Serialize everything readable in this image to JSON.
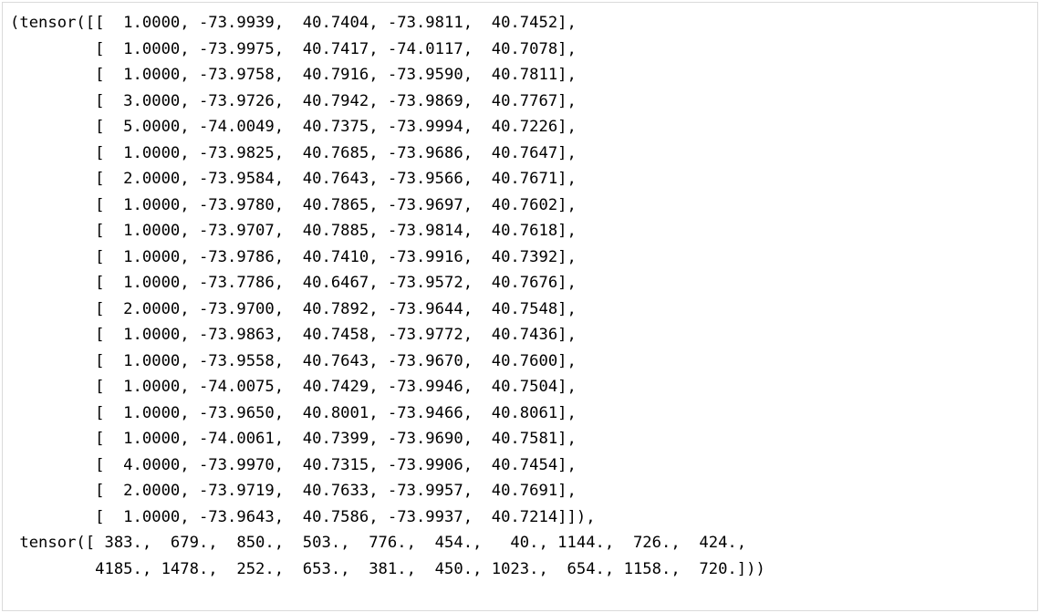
{
  "tensor1": {
    "rows": [
      [
        "  1.0000",
        "-73.9939",
        " 40.7404",
        "-73.9811",
        " 40.7452"
      ],
      [
        "  1.0000",
        "-73.9975",
        " 40.7417",
        "-74.0117",
        " 40.7078"
      ],
      [
        "  1.0000",
        "-73.9758",
        " 40.7916",
        "-73.9590",
        " 40.7811"
      ],
      [
        "  3.0000",
        "-73.9726",
        " 40.7942",
        "-73.9869",
        " 40.7767"
      ],
      [
        "  5.0000",
        "-74.0049",
        " 40.7375",
        "-73.9994",
        " 40.7226"
      ],
      [
        "  1.0000",
        "-73.9825",
        " 40.7685",
        "-73.9686",
        " 40.7647"
      ],
      [
        "  2.0000",
        "-73.9584",
        " 40.7643",
        "-73.9566",
        " 40.7671"
      ],
      [
        "  1.0000",
        "-73.9780",
        " 40.7865",
        "-73.9697",
        " 40.7602"
      ],
      [
        "  1.0000",
        "-73.9707",
        " 40.7885",
        "-73.9814",
        " 40.7618"
      ],
      [
        "  1.0000",
        "-73.9786",
        " 40.7410",
        "-73.9916",
        " 40.7392"
      ],
      [
        "  1.0000",
        "-73.7786",
        " 40.6467",
        "-73.9572",
        " 40.7676"
      ],
      [
        "  2.0000",
        "-73.9700",
        " 40.7892",
        "-73.9644",
        " 40.7548"
      ],
      [
        "  1.0000",
        "-73.9863",
        " 40.7458",
        "-73.9772",
        " 40.7436"
      ],
      [
        "  1.0000",
        "-73.9558",
        " 40.7643",
        "-73.9670",
        " 40.7600"
      ],
      [
        "  1.0000",
        "-74.0075",
        " 40.7429",
        "-73.9946",
        " 40.7504"
      ],
      [
        "  1.0000",
        "-73.9650",
        " 40.8001",
        "-73.9466",
        " 40.8061"
      ],
      [
        "  1.0000",
        "-74.0061",
        " 40.7399",
        "-73.9690",
        " 40.7581"
      ],
      [
        "  4.0000",
        "-73.9970",
        " 40.7315",
        "-73.9906",
        " 40.7454"
      ],
      [
        "  2.0000",
        "-73.9719",
        " 40.7633",
        "-73.9957",
        " 40.7691"
      ],
      [
        "  1.0000",
        "-73.9643",
        " 40.7586",
        "-73.9937",
        " 40.7214"
      ]
    ]
  },
  "tensor2": {
    "line1": [
      " 383.",
      " 679.",
      " 850.",
      " 503.",
      " 776.",
      " 454.",
      "  40.",
      "1144.",
      " 726.",
      " 424."
    ],
    "line2": [
      "4185.",
      "1478.",
      " 252.",
      " 653.",
      " 381.",
      " 450.",
      "1023.",
      " 654.",
      "1158.",
      " 720."
    ]
  }
}
